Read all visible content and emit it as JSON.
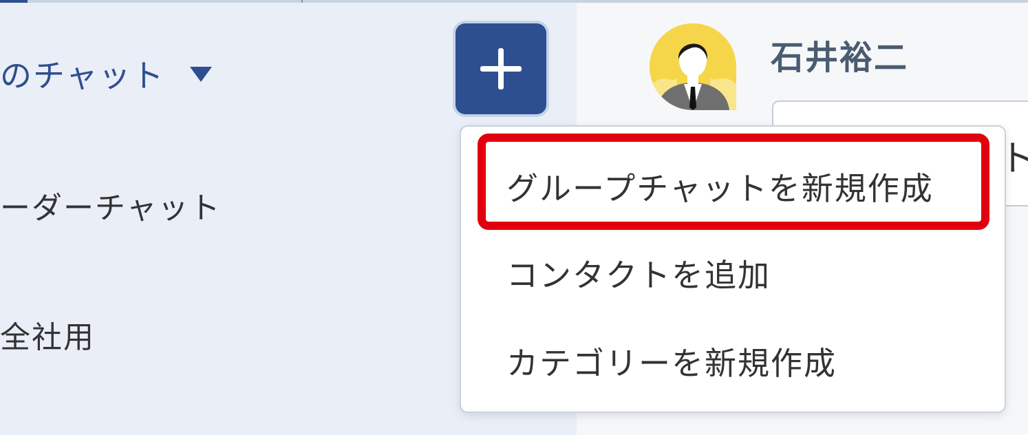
{
  "sidebar": {
    "title": "のチャット",
    "items": [
      {
        "label": "ーダーチャット"
      },
      {
        "label": "全社用"
      }
    ]
  },
  "header": {
    "user_name": "石井裕二",
    "avatar_icon": "user-avatar-icon"
  },
  "background": {
    "partial_text": "ト"
  },
  "dropdown": {
    "items": [
      {
        "label": "グループチャットを新規作成",
        "highlighted": true
      },
      {
        "label": "コンタクトを追加"
      },
      {
        "label": "カテゴリーを新規作成"
      }
    ]
  },
  "colors": {
    "accent": "#2e4f8f",
    "highlight": "#e0000f",
    "avatar_bg": "#f5d64a"
  },
  "icons": {
    "add": "plus-icon",
    "caret": "caret-down-icon"
  }
}
